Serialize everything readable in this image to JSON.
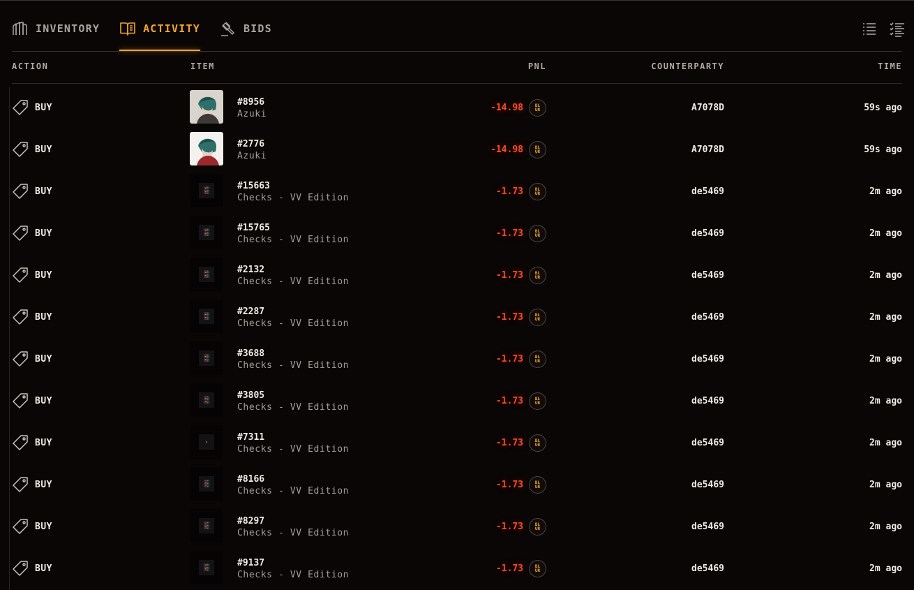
{
  "tabs": [
    {
      "label": "INVENTORY",
      "icon": "inventory-icon",
      "active": false
    },
    {
      "label": "ACTIVITY",
      "icon": "book-icon",
      "active": true
    },
    {
      "label": "BIDS",
      "icon": "gavel-icon",
      "active": false
    }
  ],
  "view_toggles": [
    "list-view-icon",
    "checklist-view-icon"
  ],
  "columns": {
    "action": "ACTION",
    "item": "ITEM",
    "pnl": "PNL",
    "counterparty": "COUNTERPARTY",
    "time": "TIME"
  },
  "coin_badge": [
    "BL",
    "UR"
  ],
  "colors": {
    "accent": "#f3a52c",
    "negative_pnl": "#ff4a1f",
    "background": "#0a0606"
  },
  "rows": [
    {
      "action": "BUY",
      "id": "#8956",
      "collection": "Azuki",
      "pnl": "-14.98",
      "counterparty": "A7078D",
      "time": "59s ago",
      "thumb": "azuki"
    },
    {
      "action": "BUY",
      "id": "#2776",
      "collection": "Azuki",
      "pnl": "-14.98",
      "counterparty": "A7078D",
      "time": "59s ago",
      "thumb": "azuki-light"
    },
    {
      "action": "BUY",
      "id": "#15663",
      "collection": "Checks - VV Edition",
      "pnl": "-1.73",
      "counterparty": "de5469",
      "time": "2m ago",
      "thumb": "checks"
    },
    {
      "action": "BUY",
      "id": "#15765",
      "collection": "Checks - VV Edition",
      "pnl": "-1.73",
      "counterparty": "de5469",
      "time": "2m ago",
      "thumb": "checks"
    },
    {
      "action": "BUY",
      "id": "#2132",
      "collection": "Checks - VV Edition",
      "pnl": "-1.73",
      "counterparty": "de5469",
      "time": "2m ago",
      "thumb": "checks"
    },
    {
      "action": "BUY",
      "id": "#2287",
      "collection": "Checks - VV Edition",
      "pnl": "-1.73",
      "counterparty": "de5469",
      "time": "2m ago",
      "thumb": "checks"
    },
    {
      "action": "BUY",
      "id": "#3688",
      "collection": "Checks - VV Edition",
      "pnl": "-1.73",
      "counterparty": "de5469",
      "time": "2m ago",
      "thumb": "checks"
    },
    {
      "action": "BUY",
      "id": "#3805",
      "collection": "Checks - VV Edition",
      "pnl": "-1.73",
      "counterparty": "de5469",
      "time": "2m ago",
      "thumb": "checks"
    },
    {
      "action": "BUY",
      "id": "#7311",
      "collection": "Checks - VV Edition",
      "pnl": "-1.73",
      "counterparty": "de5469",
      "time": "2m ago",
      "thumb": "checks-single"
    },
    {
      "action": "BUY",
      "id": "#8166",
      "collection": "Checks - VV Edition",
      "pnl": "-1.73",
      "counterparty": "de5469",
      "time": "2m ago",
      "thumb": "checks"
    },
    {
      "action": "BUY",
      "id": "#8297",
      "collection": "Checks - VV Edition",
      "pnl": "-1.73",
      "counterparty": "de5469",
      "time": "2m ago",
      "thumb": "checks"
    },
    {
      "action": "BUY",
      "id": "#9137",
      "collection": "Checks - VV Edition",
      "pnl": "-1.73",
      "counterparty": "de5469",
      "time": "2m ago",
      "thumb": "checks"
    }
  ]
}
